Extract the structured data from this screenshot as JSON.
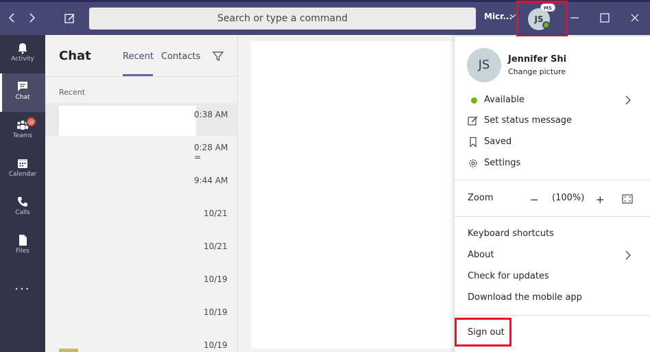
{
  "topbar": {
    "back_icon": "chevron-left-icon",
    "forward_icon": "chevron-right-icon",
    "compose_icon": "compose-icon",
    "search_placeholder": "Search or type a command",
    "org_label": "Micr...",
    "avatar_initials": "JS",
    "avatar_badge": "MS",
    "colors": {
      "bar": "#464775",
      "highlight": "#e81123"
    }
  },
  "rail": {
    "items": [
      {
        "label": "Activity",
        "icon": "bell-icon"
      },
      {
        "label": "Chat",
        "icon": "chat-icon"
      },
      {
        "label": "Teams",
        "icon": "teams-icon",
        "badge": "@"
      },
      {
        "label": "Calendar",
        "icon": "calendar-icon"
      },
      {
        "label": "Calls",
        "icon": "phone-icon"
      },
      {
        "label": "Files",
        "icon": "file-icon"
      }
    ],
    "more": "..."
  },
  "chat": {
    "title": "Chat",
    "tabs": {
      "recent": "Recent",
      "contacts": "Contacts"
    },
    "section": "Recent",
    "rows": [
      {
        "time": "0:38 AM"
      },
      {
        "time": "0:28 AM",
        "sub": "="
      },
      {
        "time": "9:44 AM"
      },
      {
        "date": "10/21"
      },
      {
        "date": "10/21"
      },
      {
        "date": "10/19"
      },
      {
        "date": "10/19"
      },
      {
        "date": "10/19"
      }
    ]
  },
  "profile": {
    "initials": "JS",
    "name": "Jennifer Shi",
    "change_picture": "Change picture",
    "status": "Available",
    "set_status": "Set status message",
    "saved": "Saved",
    "settings": "Settings",
    "zoom_label": "Zoom",
    "zoom_minus": "−",
    "zoom_value": "(100%)",
    "zoom_plus": "+",
    "keyboard_shortcuts": "Keyboard shortcuts",
    "about": "About",
    "check_updates": "Check for updates",
    "download_mobile": "Download the mobile app",
    "sign_out": "Sign out"
  }
}
